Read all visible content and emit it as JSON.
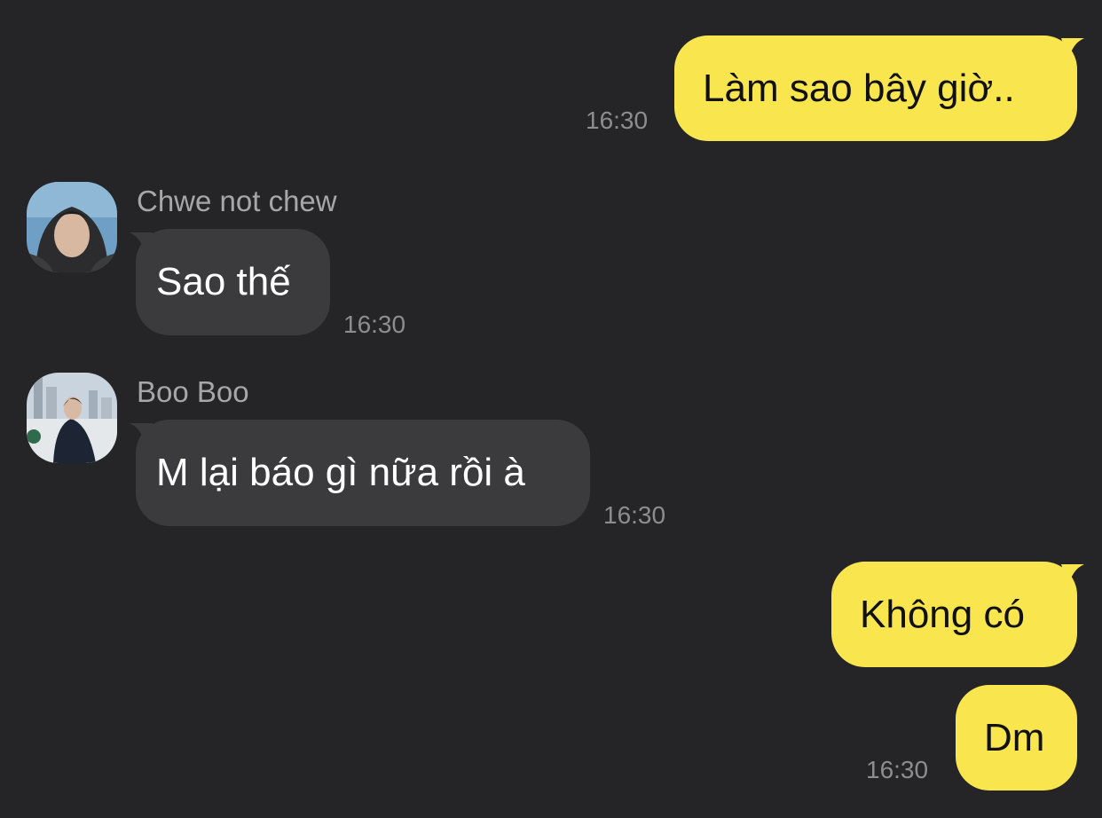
{
  "colors": {
    "background": "#252527",
    "outgoing_bubble": "#f9e54e",
    "incoming_bubble": "#3b3b3d",
    "timestamp": "#8d8d90",
    "sender_name": "#a7a7aa"
  },
  "messages": [
    {
      "direction": "outgoing",
      "text": "Làm sao bây giờ..",
      "time": "16:30"
    },
    {
      "direction": "incoming",
      "sender": "Chwe not chew",
      "avatar": "profile-photo-hooded-man",
      "text": "Sao thế",
      "time": "16:30"
    },
    {
      "direction": "incoming",
      "sender": "Boo Boo",
      "avatar": "profile-photo-man-outdoors-city",
      "text": "M lại báo gì nữa rồi à",
      "time": "16:30"
    },
    {
      "direction": "outgoing",
      "text": "Không có"
    },
    {
      "direction": "outgoing",
      "text": "Dm",
      "time": "16:30"
    }
  ]
}
